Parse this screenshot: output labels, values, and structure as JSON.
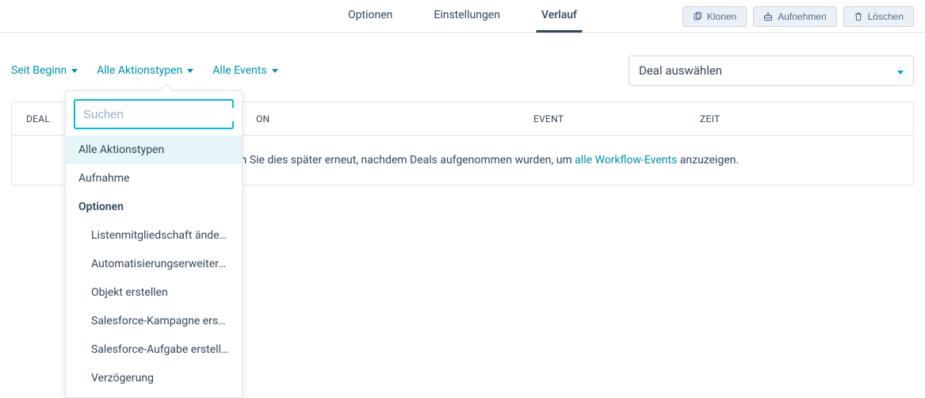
{
  "tabs": {
    "optionen": "Optionen",
    "einstellungen": "Einstellungen",
    "verlauf": "Verlauf"
  },
  "actions": {
    "klonen": "Klonen",
    "aufnehmen": "Aufnehmen",
    "loeschen": "Löschen"
  },
  "filters": {
    "since": "Seit Beginn",
    "action_types": "Alle Aktionstypen",
    "events": "Alle Events"
  },
  "deal_select": {
    "placeholder": "Deal auswählen"
  },
  "columns": {
    "deal": "DEAL",
    "aktion": "ON",
    "event": "EVENT",
    "zeit": "ZEIT"
  },
  "empty_message": {
    "p1": ". Überprüfen Sie dies später erneut, nachdem Deals aufgenommen wurden, um ",
    "link": "alle Workflow-Events",
    "p2": " anzuzeigen."
  },
  "dropdown": {
    "search_placeholder": "Suchen",
    "items": [
      {
        "label": "Alle Aktionstypen",
        "type": "selected"
      },
      {
        "label": "Aufnahme",
        "type": "item"
      },
      {
        "label": "Optionen",
        "type": "header"
      },
      {
        "label": "Listenmitgliedschaft ändern",
        "type": "sub"
      },
      {
        "label": "Automatisierungserweiteru…",
        "type": "sub"
      },
      {
        "label": "Objekt erstellen",
        "type": "sub"
      },
      {
        "label": "Salesforce-Kampagne erste…",
        "type": "sub"
      },
      {
        "label": "Salesforce-Aufgabe erstellen",
        "type": "sub"
      },
      {
        "label": "Verzögerung",
        "type": "sub"
      }
    ]
  }
}
